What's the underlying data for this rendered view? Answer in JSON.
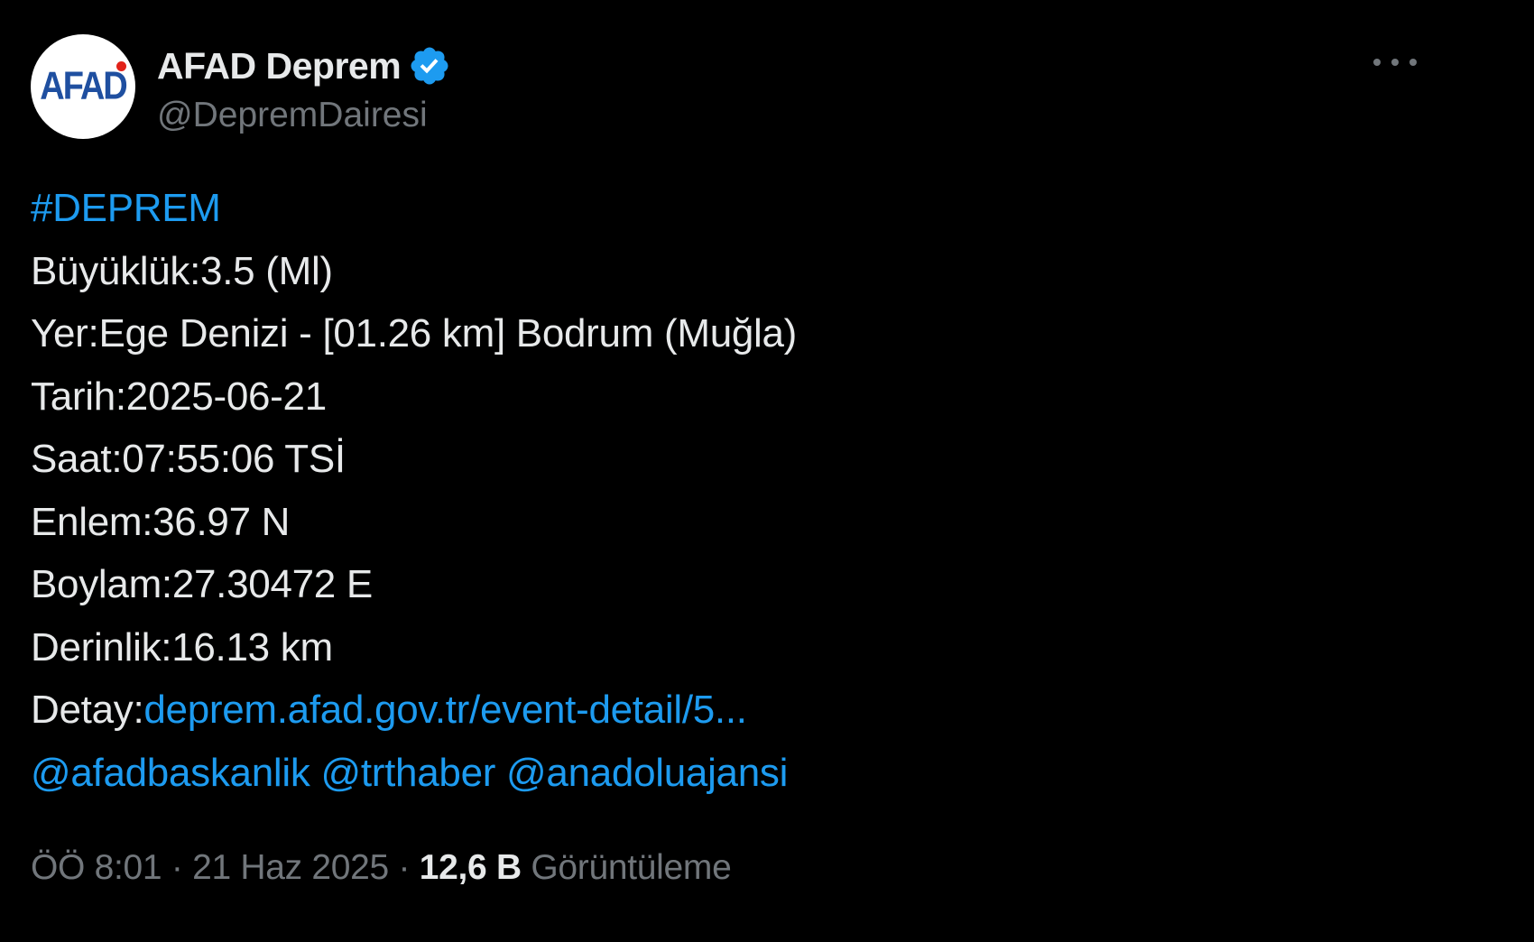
{
  "author": {
    "avatar_text": "AFAD",
    "display_name": "AFAD Deprem",
    "verified_icon": "verified-badge-icon",
    "handle": "@DepremDairesi"
  },
  "menu": {
    "icon": "more-options-icon"
  },
  "tweet": {
    "hashtag": "#DEPREM",
    "magnitude": "Büyüklük:3.5 (Ml)",
    "location": "Yer:Ege Denizi - [01.26 km] Bodrum (Muğla)",
    "date": "Tarih:2025-06-21",
    "time": "Saat:07:55:06 TSİ",
    "latitude": "Enlem:36.97 N",
    "longitude": "Boylam:27.30472 E",
    "depth": "Derinlik:16.13 km",
    "detail_label": "Detay:",
    "detail_link": "deprem.afad.gov.tr/event-detail/5...",
    "mentions": [
      "@afadbaskanlik",
      "@trthaber",
      "@anadoluajansi"
    ]
  },
  "footer": {
    "time": "ÖÖ 8:01",
    "separator1": " · ",
    "date": "21 Haz 2025",
    "separator2": " · ",
    "views_count": "12,6 B",
    "views_label": " Görüntüleme"
  },
  "colors": {
    "background": "#000000",
    "text": "#e7e9ea",
    "secondary": "#71767b",
    "link": "#1d9bf0",
    "verified": "#1d9bf0"
  }
}
